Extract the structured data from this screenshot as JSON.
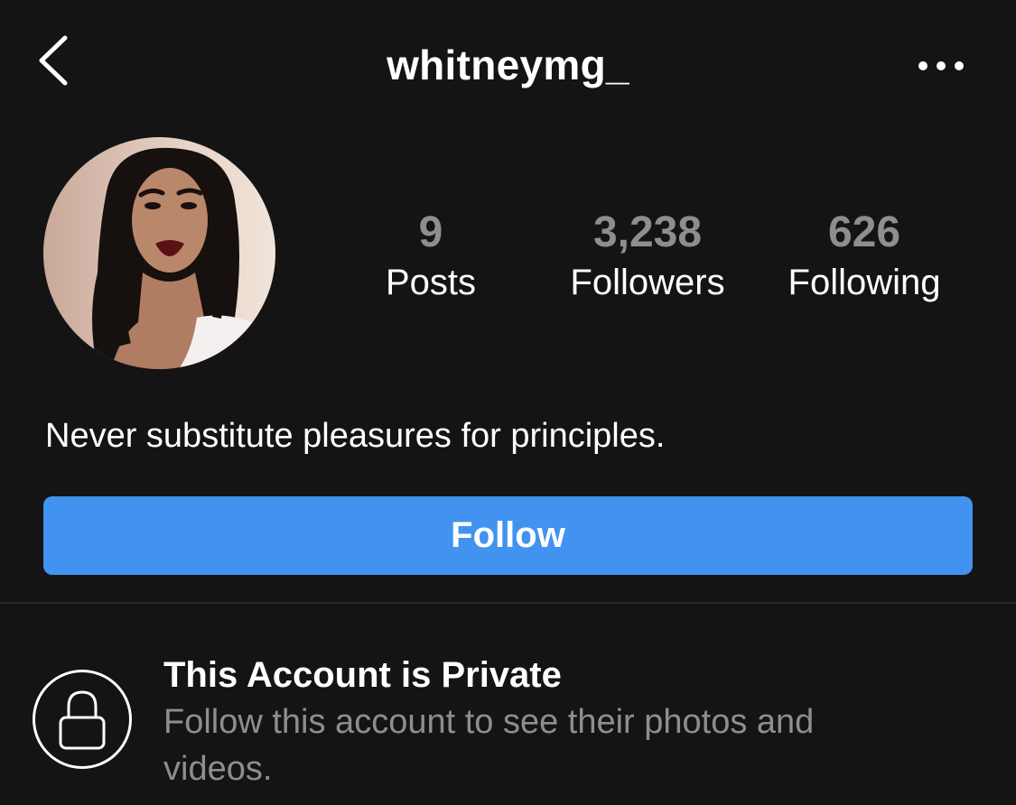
{
  "header": {
    "username": "whitneymg_",
    "back_icon": "chevron-left-icon",
    "more_icon": "more-horizontal-icon"
  },
  "profile": {
    "avatar": "profile-photo",
    "stats": [
      {
        "value": "9",
        "label": "Posts"
      },
      {
        "value": "3,238",
        "label": "Followers"
      },
      {
        "value": "626",
        "label": "Following"
      }
    ],
    "bio": "Never substitute pleasures for principles."
  },
  "follow_button": {
    "label": "Follow",
    "color": "#4193ef"
  },
  "private_notice": {
    "icon": "lock-icon",
    "title": "This Account is Private",
    "description": "Follow this account to see their photos and videos."
  },
  "colors": {
    "background": "#141414",
    "secondary_text": "#8e8e8e",
    "divider": "#262626"
  }
}
